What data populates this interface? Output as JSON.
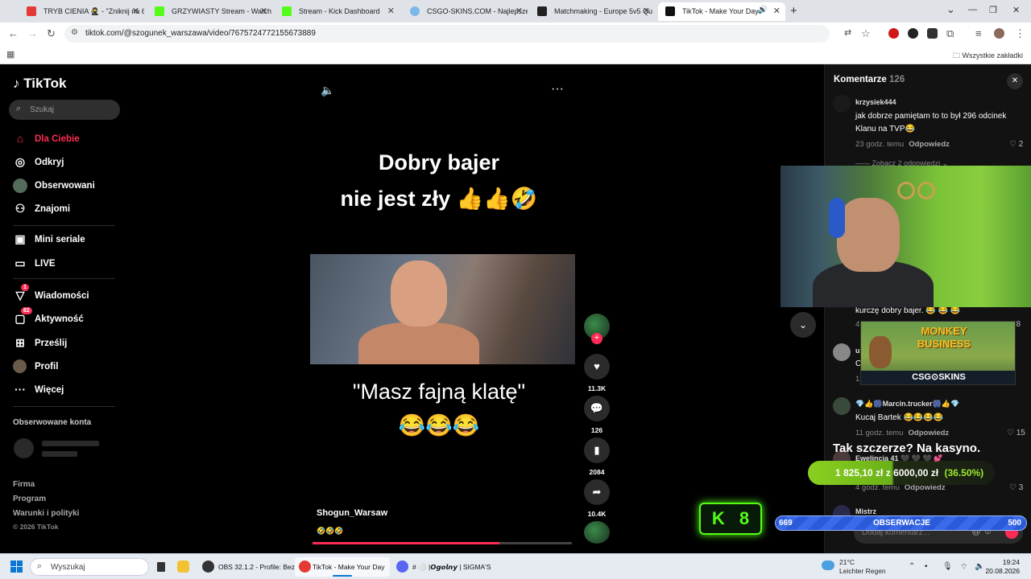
{
  "browser": {
    "tabs": [
      {
        "title": "TRYB CIENIA 🥷 - \"Zniknij na 6",
        "color": "#e53935",
        "active": false
      },
      {
        "title": "GRZYWIASTY Stream - Watch L",
        "color": "#53fc18",
        "active": false
      },
      {
        "title": "Stream - Kick Dashboard",
        "color": "#53fc18",
        "active": false
      },
      {
        "title": "CSGO-SKINS.COM - Najlepsze",
        "color": "#7ab8e8",
        "active": false
      },
      {
        "title": "Matchmaking - Europe 5v5 Qu",
        "color": "#222222",
        "active": false
      },
      {
        "title": "TikTok - Make Your Day",
        "color": "#111111",
        "active": true
      }
    ],
    "url": "tiktok.com/@szogunek_warszawa/video/7675724772155673889",
    "bookmarks_all": "Wszystkie zakładki"
  },
  "tiktok": {
    "logo": "TikTok",
    "search_placeholder": "Szukaj",
    "nav": [
      {
        "label": "Dla Ciebie",
        "icon": "home-icon"
      },
      {
        "label": "Odkryj",
        "icon": "compass-icon"
      },
      {
        "label": "Obserwowani",
        "icon": "following-avatar-icon"
      },
      {
        "label": "Znajomi",
        "icon": "friends-icon"
      },
      {
        "label": "Mini seriale",
        "icon": "mini-series-icon"
      },
      {
        "label": "LIVE",
        "icon": "live-tv-icon"
      },
      {
        "label": "Wiadomości",
        "icon": "messages-icon",
        "badge": "1"
      },
      {
        "label": "Aktywność",
        "icon": "activity-icon",
        "badge": "82"
      },
      {
        "label": "Prześlij",
        "icon": "upload-icon"
      },
      {
        "label": "Profil",
        "icon": "profile-icon"
      },
      {
        "label": "Więcej",
        "icon": "more-icon"
      }
    ],
    "followed_title": "Obserwowane konta",
    "footer": [
      "Firma",
      "Program",
      "Warunki i polityki"
    ],
    "copyright": "© 2026 TikTok"
  },
  "video": {
    "caption_top_line1": "Dobry bajer",
    "caption_top_line2": "nie jest zły 👍👍🤣",
    "caption_bottom": "\"Masz fajną klatę\"",
    "caption_bottom_emoji": "😂😂😂",
    "author": "Shogun_Warsaw",
    "description": "🤣🤣🤣",
    "progress": 0.72,
    "likes": "11.3K",
    "comments": "126",
    "saves": "2084",
    "shares": "10.4K"
  },
  "comments_panel": {
    "title": "Komentarze",
    "count": "126",
    "items": [
      {
        "user": "krzysiek444",
        "text": "jak dobrze pamiętam to to był 296 odcinek Klanu na TVP😂",
        "time": "23 godz. temu",
        "reply": "Odpowiedz",
        "likes": "2"
      },
      {
        "user": "💎👍🎆Marcin.trucker🎆👍💎",
        "text": "Kucaj Bartek 😂😂😂😂",
        "time": "11 godz. temu",
        "reply": "Odpowiedz",
        "likes": "15"
      }
    ],
    "more_replies": "Zobacz 2 odpowiedzi",
    "partial_text": "kurczę dobry bajer. 😂 😂 😂",
    "partial_user": "Ewelincia 41 🖤 🖤 🖤 💕",
    "partial_time": "4 godz. temu",
    "partial_reply": "Odpowiedz",
    "partial_likes": "3",
    "partial_likes_top": "58",
    "partial_user_short": "us",
    "partial_text_short": "C",
    "partial_meta_short": "1",
    "partial_meta_top": "4",
    "partial_last_user": "Mistrz",
    "input_placeholder": "Dodaj komentarz..."
  },
  "overlay": {
    "tak_text": "Tak szczerze? Na kasyno.",
    "bet_amount": "1 825,10 zł",
    "bet_goal": "z 6000,00 zł",
    "bet_pct": "(36.50%)",
    "kick_count": "8",
    "casino_title": "MONKEY BUSINESS",
    "casino_brand": "CSG⊙SKINS",
    "obs_left": "669",
    "obs_label": "OBSERWACJE",
    "obs_right": "500"
  },
  "taskbar": {
    "search": "Wyszukaj",
    "apps": [
      {
        "label": "OBS 32.1.2 - Profile: Bez",
        "color": "#333333",
        "active": false
      },
      {
        "label": "TikTok - Make Your Day",
        "color": "#e53935",
        "active": true
      },
      {
        "label": "# ⚪ |𝙊𝙜𝙤𝙡𝙣𝙮 | SIGMA'S",
        "color": "#5865f2",
        "active": false
      }
    ],
    "weather_temp": "21°C",
    "weather_desc": "Leichter Regen",
    "time": "19:24",
    "date": "20.08.2026"
  }
}
